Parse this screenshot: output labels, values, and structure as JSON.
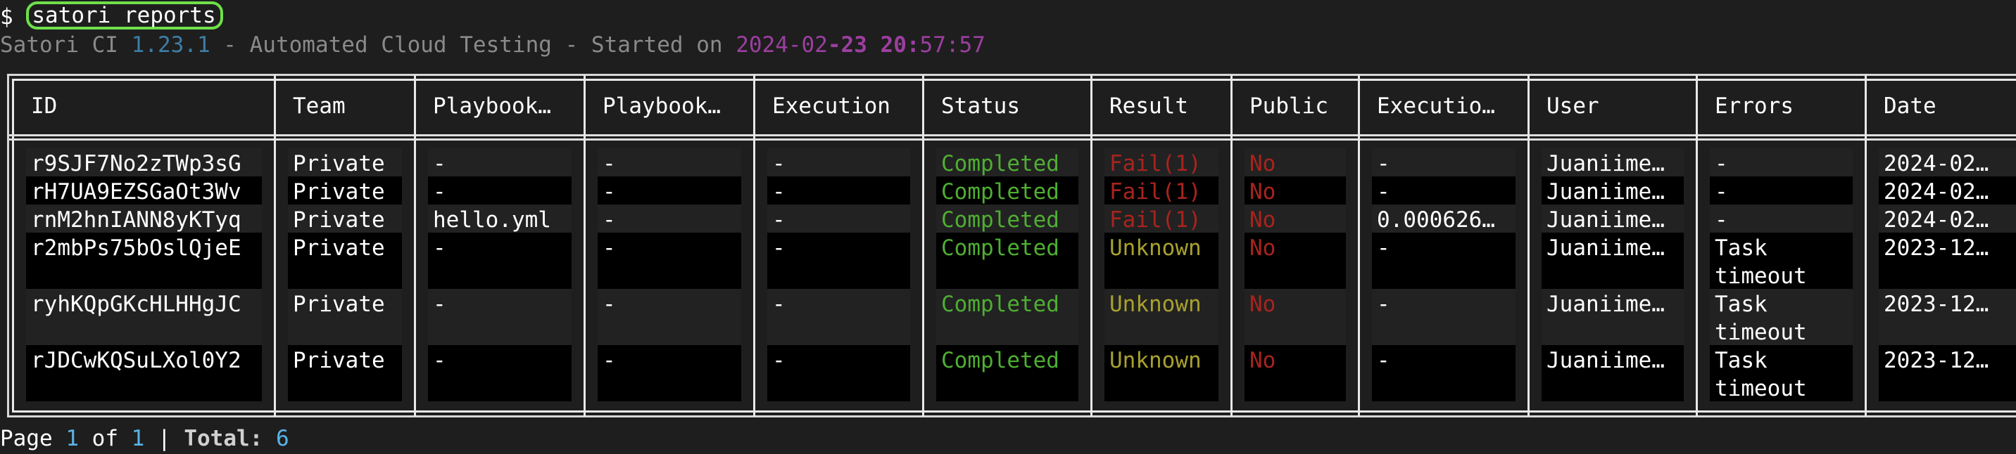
{
  "terminal": {
    "prompt": "$",
    "command": "satori reports"
  },
  "info": {
    "app_name": "Satori CI",
    "version": "1.23.1",
    "separator1": " - ",
    "description": "Automated Cloud Testing",
    "separator2": " - ",
    "started_label": "Started on",
    "date_part1": "2024-02",
    "date_part2_bold": "-23 20:",
    "date_part3": "57:57"
  },
  "table": {
    "columns": [
      "ID",
      "Team",
      "Playbook…",
      "Playbook…",
      "Execution",
      "Status",
      "Result",
      "Public",
      "Executio…",
      "User",
      "Errors",
      "Date"
    ],
    "rows": [
      {
        "id": "r9SJF7No2zTWp3sG",
        "team": "Private",
        "playbook1": "-",
        "playbook2": "-",
        "execution": "-",
        "status": "Completed",
        "result": "Fail(1)",
        "public": "No",
        "execution_time": "-",
        "user": "Juaniime…",
        "errors": [
          "-"
        ],
        "date": "2024-02…"
      },
      {
        "id": "rH7UA9EZSGaOt3Wv",
        "team": "Private",
        "playbook1": "-",
        "playbook2": "-",
        "execution": "-",
        "status": "Completed",
        "result": "Fail(1)",
        "public": "No",
        "execution_time": "-",
        "user": "Juaniime…",
        "errors": [
          "-"
        ],
        "date": "2024-02…"
      },
      {
        "id": "rnM2hnIANN8yKTyq",
        "team": "Private",
        "playbook1": "hello.yml",
        "playbook2": "-",
        "execution": "-",
        "status": "Completed",
        "result": "Fail(1)",
        "public": "No",
        "execution_time": "0.000626…",
        "user": "Juaniime…",
        "errors": [
          "-"
        ],
        "date": "2024-02…"
      },
      {
        "id": "r2mbPs75bOslQjeE",
        "team": "Private",
        "playbook1": "-",
        "playbook2": "-",
        "execution": "-",
        "status": "Completed",
        "result": "Unknown",
        "public": "No",
        "execution_time": "-",
        "user": "Juaniime…",
        "errors": [
          "Task",
          "timeout"
        ],
        "date": "2023-12…"
      },
      {
        "id": "ryhKQpGKcHLHHgJC",
        "team": "Private",
        "playbook1": "-",
        "playbook2": "-",
        "execution": "-",
        "status": "Completed",
        "result": "Unknown",
        "public": "No",
        "execution_time": "-",
        "user": "Juaniime…",
        "errors": [
          "Task",
          "timeout"
        ],
        "date": "2023-12…"
      },
      {
        "id": "rJDCwKQSuLXol0Y2",
        "team": "Private",
        "playbook1": "-",
        "playbook2": "-",
        "execution": "-",
        "status": "Completed",
        "result": "Unknown",
        "public": "No",
        "execution_time": "-",
        "user": "Juaniime…",
        "errors": [
          "Task",
          "timeout"
        ],
        "date": "2023-12…"
      }
    ]
  },
  "footer": {
    "page_label": "Page",
    "current_page": "1",
    "of_label": "of",
    "total_pages": "1",
    "separator": "|",
    "total_label": "Total:",
    "total_count": "6"
  },
  "colors": {
    "status_completed": "#4fae33",
    "result_fail": "#a8241e",
    "result_unknown": "#a8a12e",
    "public_no": "#a8241e",
    "version": "#3d7ea6",
    "date": "#9b3f9f",
    "pagination_numbers": "#5ab4e8",
    "command_highlight": "#6ee04a"
  }
}
